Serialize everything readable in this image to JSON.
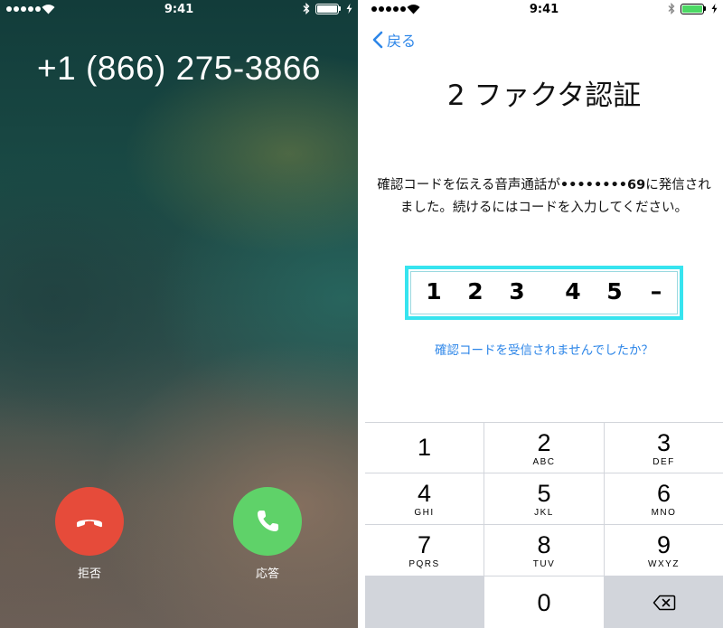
{
  "call": {
    "status_time": "9:41",
    "phone_number": "+1 (866) 275-3866",
    "decline_label": "拒否",
    "accept_label": "応答",
    "decline_color": "#e64b3a",
    "accept_color": "#5fd269"
  },
  "auth": {
    "status_time": "9:41",
    "back_label": "戻る",
    "title": "2 ファクタ認証",
    "description_prefix": "確認コードを伝える音声通話が",
    "description_masked": "••••••••69",
    "description_suffix": "に発信されました。続けるにはコードを入力してください。",
    "code_digits": [
      "1",
      "2",
      "3",
      "4",
      "5",
      "–"
    ],
    "resend_link": "確認コードを受信されませんでしたか？",
    "accent_color": "#2d86e8",
    "highlight_color": "#37e4ef"
  },
  "keypad": {
    "keys": [
      {
        "num": "1",
        "letters": ""
      },
      {
        "num": "2",
        "letters": "ABC"
      },
      {
        "num": "3",
        "letters": "DEF"
      },
      {
        "num": "4",
        "letters": "GHI"
      },
      {
        "num": "5",
        "letters": "JKL"
      },
      {
        "num": "6",
        "letters": "MNO"
      },
      {
        "num": "7",
        "letters": "PQRS"
      },
      {
        "num": "8",
        "letters": "TUV"
      },
      {
        "num": "9",
        "letters": "WXYZ"
      },
      {
        "num": "0",
        "letters": ""
      }
    ],
    "delete_icon": "backspace-icon"
  }
}
